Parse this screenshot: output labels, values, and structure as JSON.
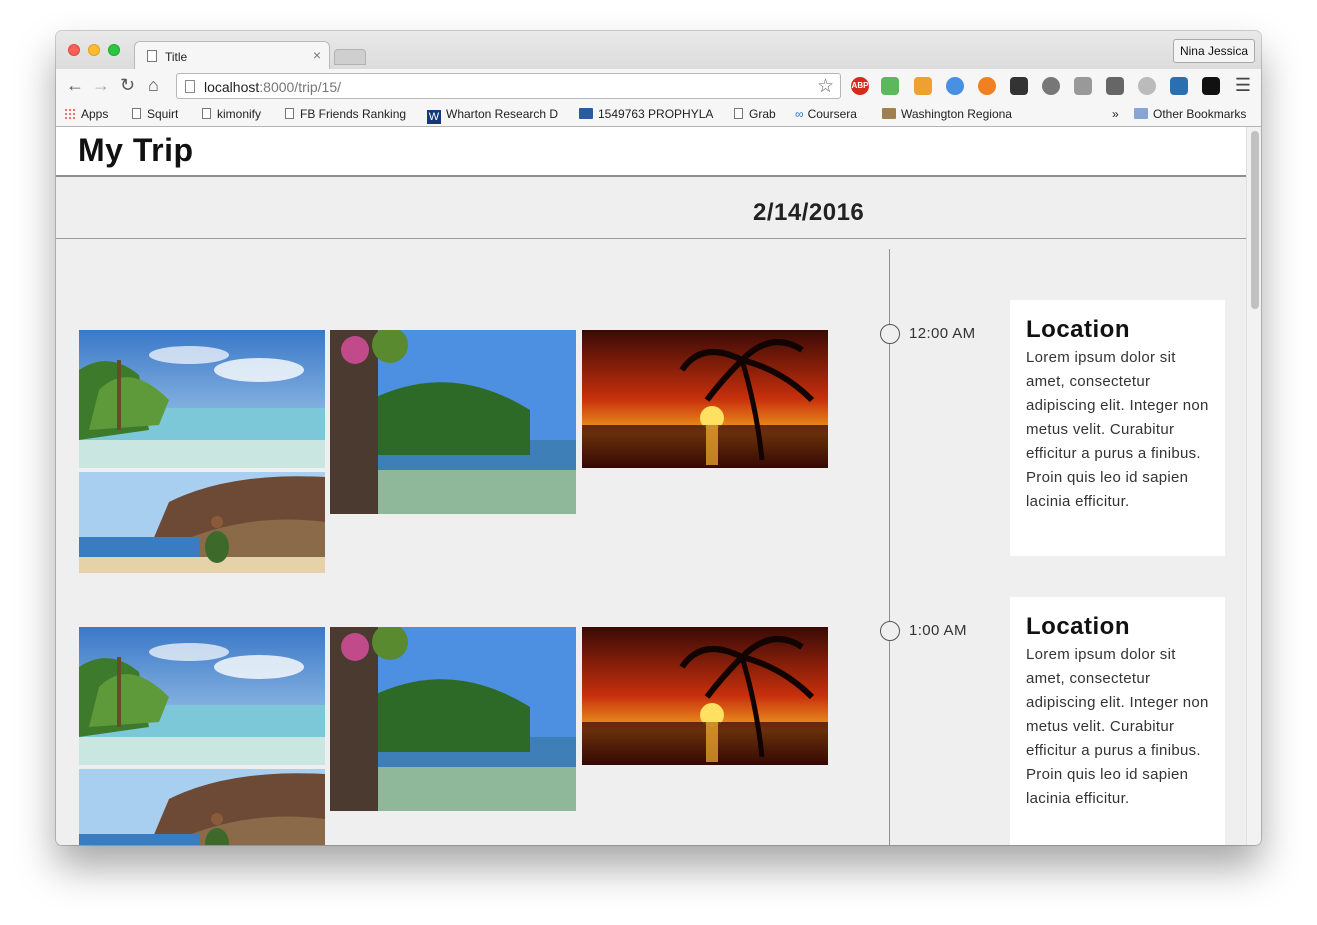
{
  "browser": {
    "tab_title": "Title",
    "tab_close": "×",
    "profile_name": "Nina Jessica",
    "url_host": "localhost",
    "url_rest": ":8000/trip/15/",
    "bookmarks": [
      {
        "label": "Apps"
      },
      {
        "label": "Squirt"
      },
      {
        "label": "kimonify"
      },
      {
        "label": "FB Friends Ranking"
      },
      {
        "label": "Wharton Research D"
      },
      {
        "label": "1549763 PROPHYLA"
      },
      {
        "label": "Grab"
      },
      {
        "label": "Coursera"
      },
      {
        "label": "Washington Regiona"
      }
    ],
    "bookmarks_overflow": "»",
    "other_bookmarks": "Other Bookmarks",
    "extensions": [
      "ABP"
    ]
  },
  "page": {
    "title": "My Trip",
    "date": "2/14/2016",
    "entries": [
      {
        "time": "12:00 AM",
        "location": "Location",
        "description": "Lorem ipsum dolor sit amet, consectetur adipiscing elit. Integer non metus velit. Curabitur efficitur a purus a finibus. Proin quis leo id sapien lacinia efficitur."
      },
      {
        "time": "1:00 AM",
        "location": "Location",
        "description": "Lorem ipsum dolor sit amet, consectetur adipiscing elit. Integer non metus velit. Curabitur efficitur a purus a finibus. Proin quis leo id sapien lacinia efficitur."
      }
    ]
  },
  "colors": {
    "page_bg": "#efefef",
    "card_bg": "#ffffff",
    "timeline": "#8f8f8f"
  }
}
